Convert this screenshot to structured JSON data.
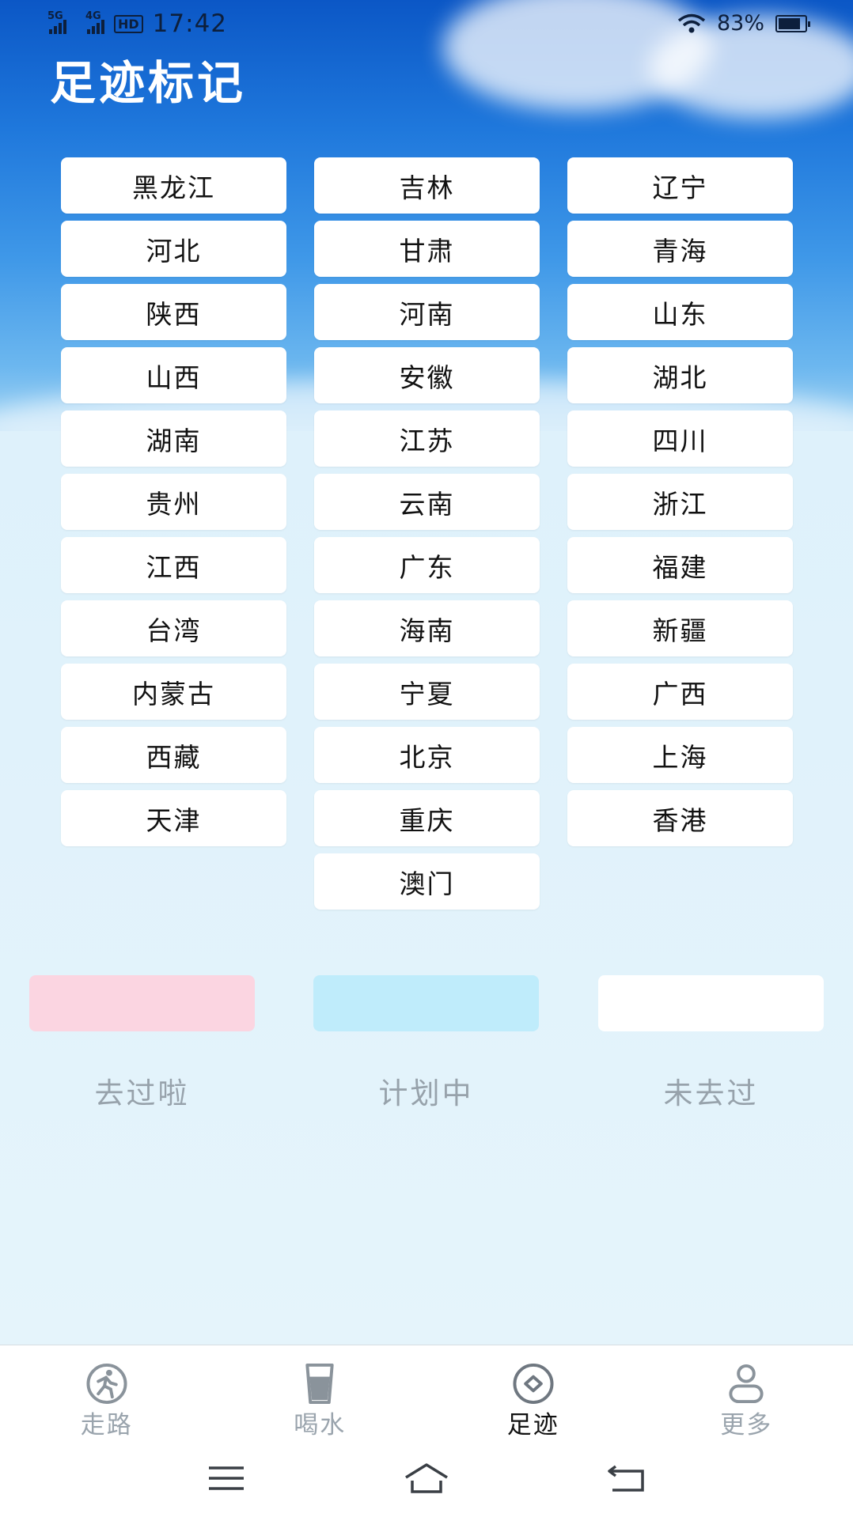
{
  "status": {
    "sig1_tag": "5G",
    "sig2_tag": "4G",
    "hd": "HD",
    "time": "17:42",
    "battery_text": "83%",
    "battery_level": 0.83
  },
  "title": "足迹标记",
  "provinces": [
    "黑龙江",
    "吉林",
    "辽宁",
    "河北",
    "甘肃",
    "青海",
    "陕西",
    "河南",
    "山东",
    "山西",
    "安徽",
    "湖北",
    "湖南",
    "江苏",
    "四川",
    "贵州",
    "云南",
    "浙江",
    "江西",
    "广东",
    "福建",
    "台湾",
    "海南",
    "新疆",
    "内蒙古",
    "宁夏",
    "广西",
    "西藏",
    "北京",
    "上海",
    "天津",
    "重庆",
    "香港",
    "澳门"
  ],
  "legend": [
    {
      "label": "去过啦",
      "color": "#fbd5e1"
    },
    {
      "label": "计划中",
      "color": "#bfecfb"
    },
    {
      "label": "未去过",
      "color": "#ffffff"
    }
  ],
  "tabs": [
    {
      "label": "走路",
      "icon": "walk-icon",
      "active": false
    },
    {
      "label": "喝水",
      "icon": "cup-icon",
      "active": false
    },
    {
      "label": "足迹",
      "icon": "footprint-icon",
      "active": true
    },
    {
      "label": "更多",
      "icon": "person-icon",
      "active": false
    }
  ],
  "nav": {
    "menu": "menu-icon",
    "home": "home-icon",
    "back": "back-icon"
  }
}
